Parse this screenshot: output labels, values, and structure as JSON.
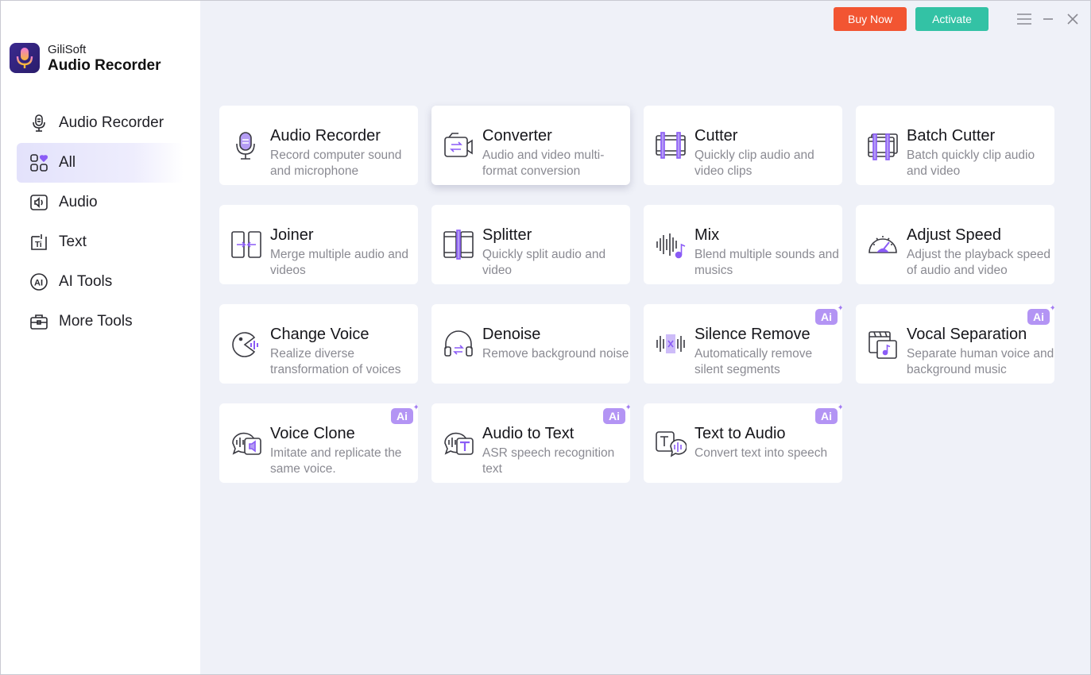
{
  "brand": {
    "company": "GiliSoft",
    "product": "Audio Recorder"
  },
  "header": {
    "buy_label": "Buy Now",
    "activate_label": "Activate"
  },
  "colors": {
    "accent": "#8b5cf6",
    "buy": "#f25532",
    "activate": "#33c2a5",
    "background": "#eff1f8"
  },
  "sidebar": {
    "items": [
      {
        "label": "Audio Recorder",
        "icon": "microphone-icon"
      },
      {
        "label": "All",
        "icon": "grid-heart-icon",
        "active": true
      },
      {
        "label": "Audio",
        "icon": "audio-icon"
      },
      {
        "label": "Text",
        "icon": "text-icon"
      },
      {
        "label": "AI Tools",
        "icon": "ai-icon"
      },
      {
        "label": "More Tools",
        "icon": "toolbox-icon"
      }
    ]
  },
  "tools": [
    {
      "title": "Audio Recorder",
      "desc": "Record computer sound and microphone",
      "icon": "microphone-icon",
      "ai": false
    },
    {
      "title": "Converter",
      "desc": "Audio and video multi-format conversion",
      "icon": "converter-icon",
      "ai": false
    },
    {
      "title": "Cutter",
      "desc": "Quickly clip audio and video clips",
      "icon": "cutter-icon",
      "ai": false
    },
    {
      "title": "Batch Cutter",
      "desc": "Batch quickly clip audio and video",
      "icon": "batch-cutter-icon",
      "ai": false
    },
    {
      "title": "Joiner",
      "desc": "Merge multiple audio and videos",
      "icon": "joiner-icon",
      "ai": false
    },
    {
      "title": "Splitter",
      "desc": "Quickly split audio and video",
      "icon": "splitter-icon",
      "ai": false
    },
    {
      "title": "Mix",
      "desc": "Blend multiple sounds and musics",
      "icon": "mix-icon",
      "ai": false
    },
    {
      "title": "Adjust Speed",
      "desc": "Adjust the playback speed of audio and video",
      "icon": "speedometer-icon",
      "ai": false
    },
    {
      "title": "Change Voice",
      "desc": "Realize diverse transformation of voices",
      "icon": "change-voice-icon",
      "ai": false
    },
    {
      "title": "Denoise",
      "desc": "Remove background noise",
      "icon": "headphones-icon",
      "ai": false
    },
    {
      "title": "Silence Remove",
      "desc": "Automatically remove silent segments",
      "icon": "silence-remove-icon",
      "ai": true
    },
    {
      "title": "Vocal Separation",
      "desc": "Separate human voice and background music",
      "icon": "vocal-separation-icon",
      "ai": true
    },
    {
      "title": "Voice Clone",
      "desc": "Imitate and replicate the same voice.",
      "icon": "voice-clone-icon",
      "ai": true
    },
    {
      "title": "Audio to Text",
      "desc": "ASR speech recognition text",
      "icon": "audio-to-text-icon",
      "ai": true
    },
    {
      "title": "Text to Audio",
      "desc": "Convert text into speech",
      "icon": "text-to-audio-icon",
      "ai": true
    }
  ],
  "ai_badge_label": "Ai"
}
